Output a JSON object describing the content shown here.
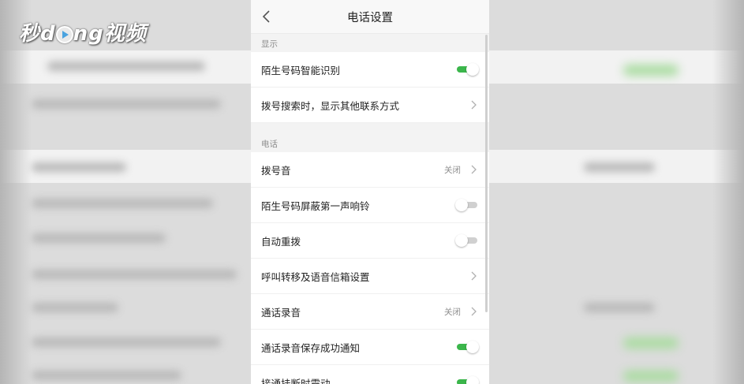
{
  "watermark": {
    "text_pre": "秒",
    "text_mid": "d",
    "text_post": "ng视频",
    "icon": "play-icon"
  },
  "header": {
    "title": "电话设置",
    "back_icon": "chevron-left-icon"
  },
  "sections": [
    {
      "title": "显示",
      "rows": [
        {
          "label": "陌生号码智能识别",
          "control": "toggle",
          "on": true
        },
        {
          "label": "拨号搜索时，显示其他联系方式",
          "control": "chevron"
        }
      ]
    },
    {
      "title": "电话",
      "rows": [
        {
          "label": "拨号音",
          "control": "chevron",
          "value": "关闭"
        },
        {
          "label": "陌生号码屏蔽第一声响铃",
          "control": "toggle",
          "on": false
        },
        {
          "label": "自动重拨",
          "control": "toggle",
          "on": false
        },
        {
          "label": "呼叫转移及语音信箱设置",
          "control": "chevron"
        },
        {
          "label": "通话录音",
          "control": "chevron",
          "value": "关闭"
        },
        {
          "label": "通话录音保存成功通知",
          "control": "toggle",
          "on": true
        },
        {
          "label": "接通挂断时震动",
          "control": "toggle",
          "on": true
        }
      ]
    }
  ],
  "colors": {
    "toggle_on": "#3bb64b",
    "toggle_off": "#d0d0d0",
    "section_bg": "#f3f3f3"
  }
}
